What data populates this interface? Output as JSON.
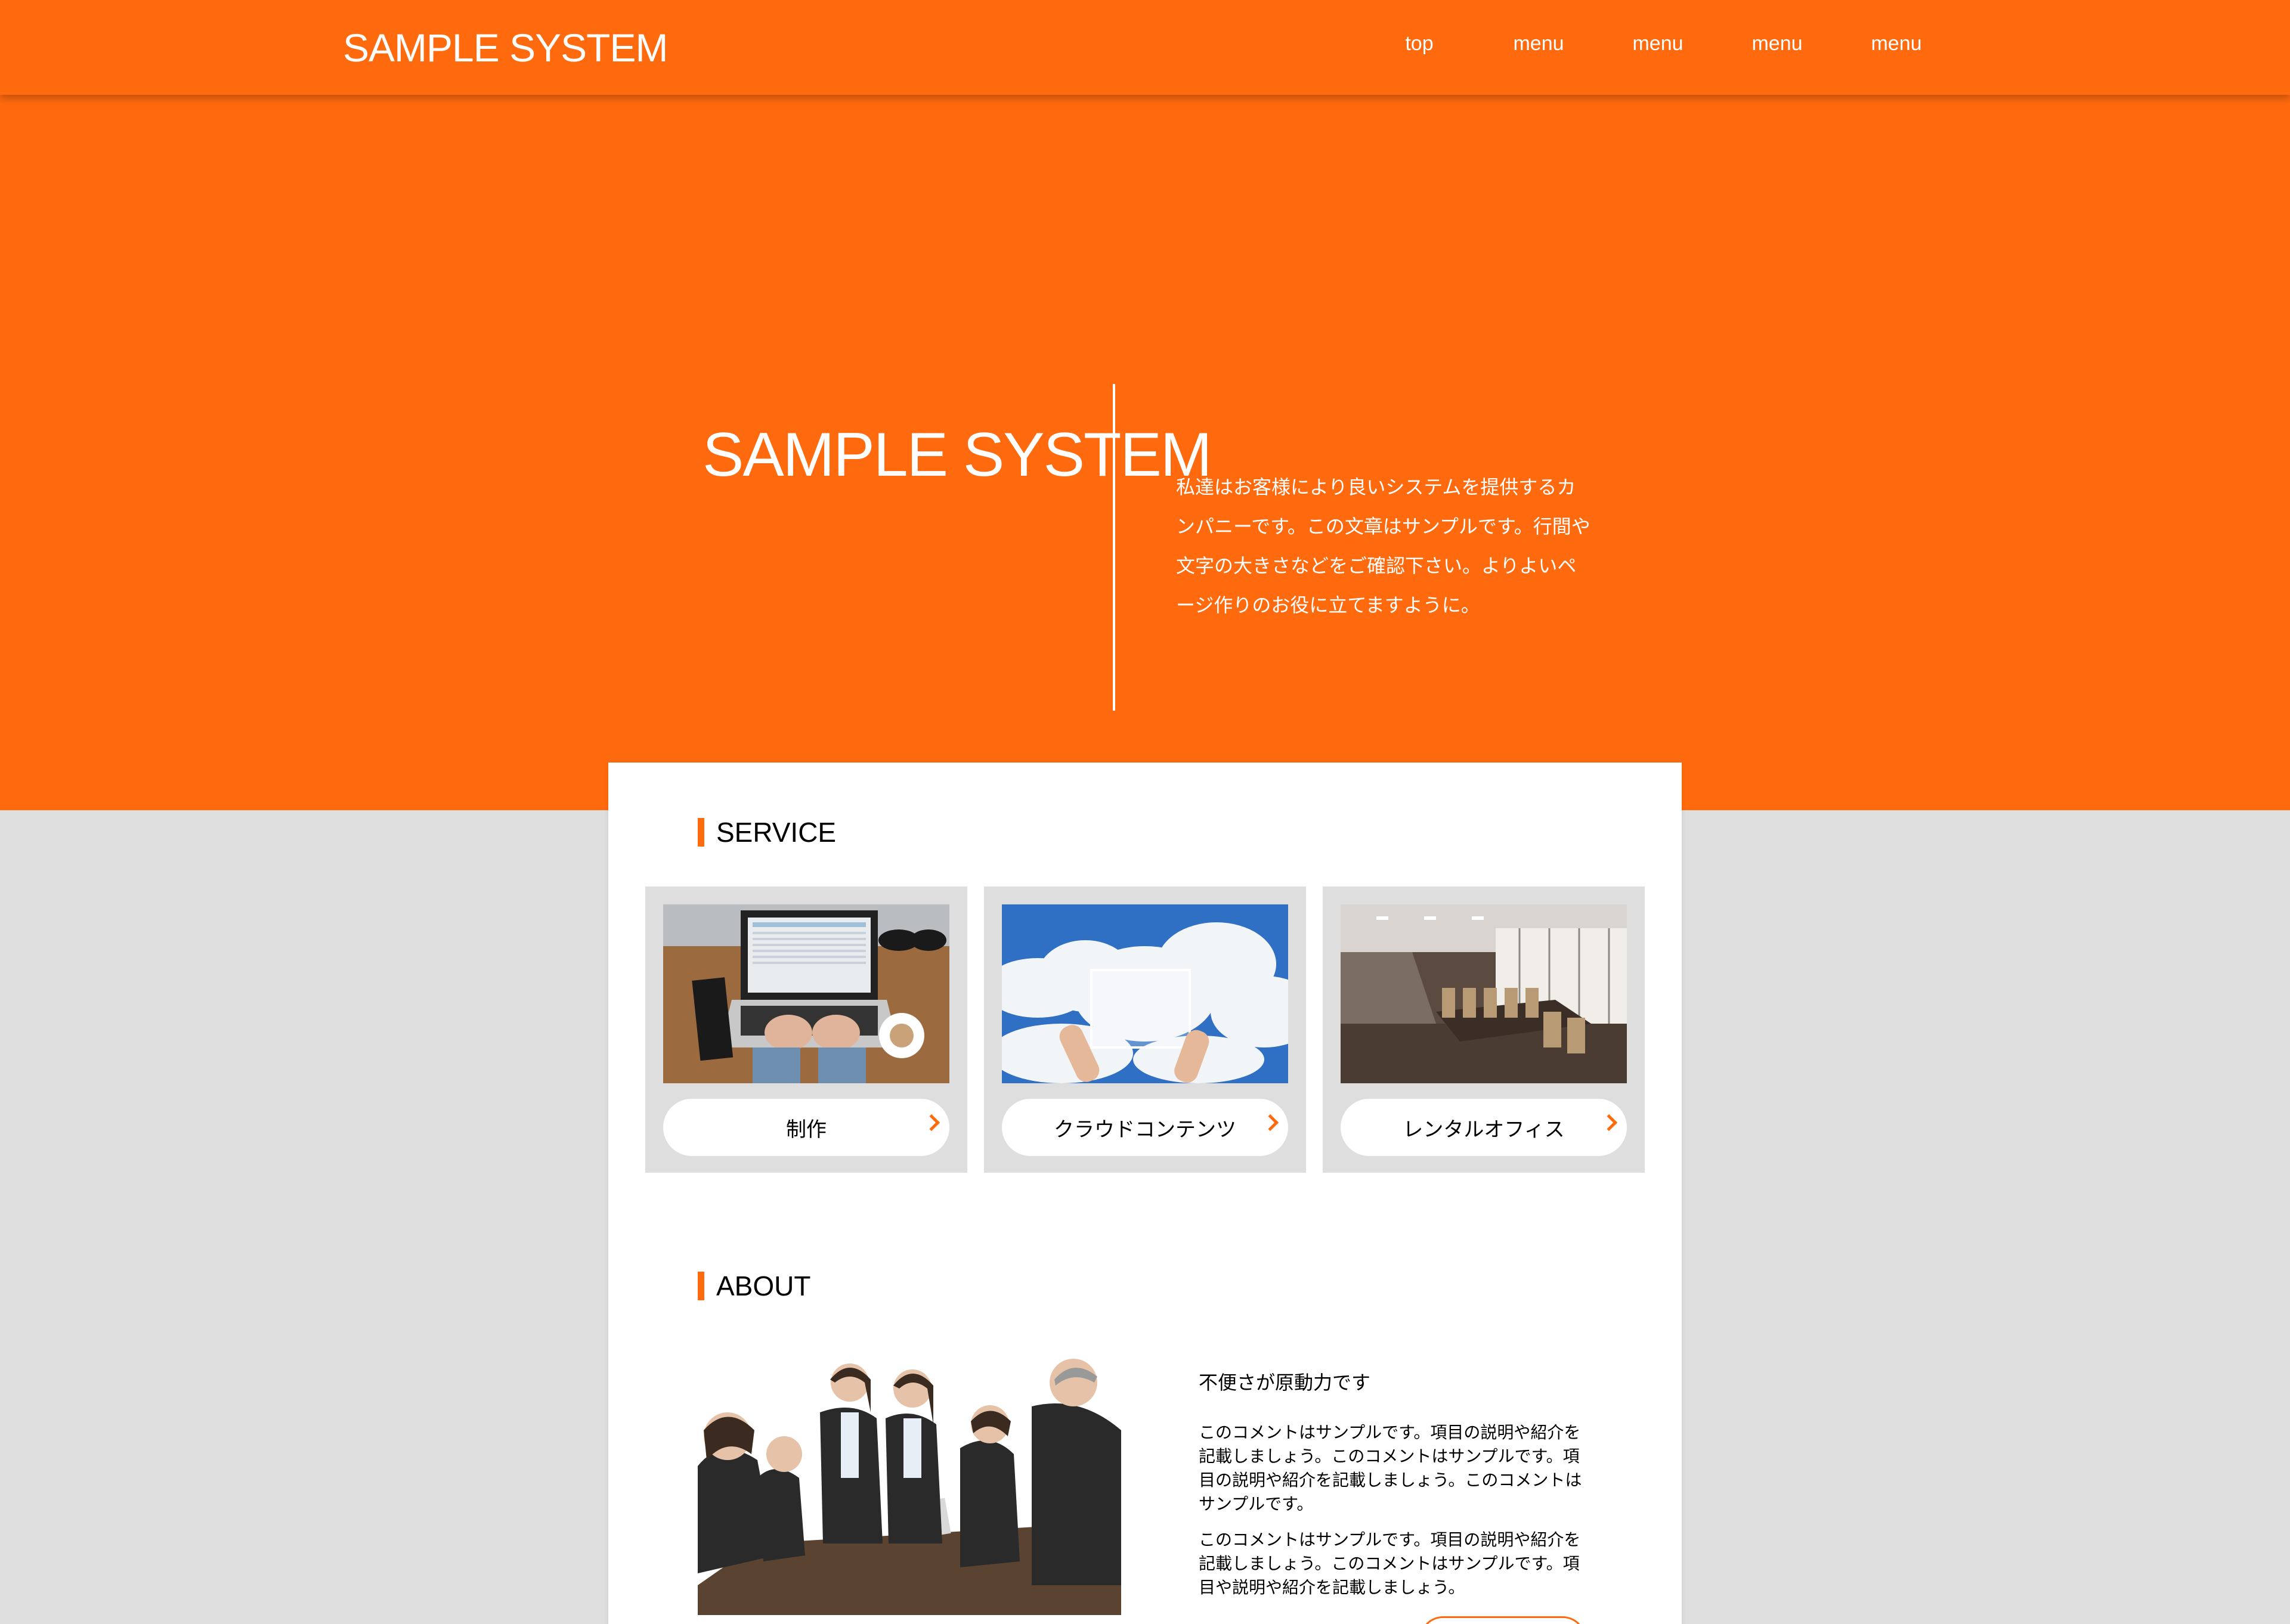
{
  "header": {
    "logo": "SAMPLE SYSTEM",
    "nav": [
      "top",
      "menu",
      "menu",
      "menu",
      "menu"
    ]
  },
  "hero": {
    "title": "SAMPLE SYSTEM",
    "text": "私達はお客様により良いシステムを提供するカンパニーです。この文章はサンプルです。行間や文字の大きさなどをご確認下さい。よりよいページ作りのお役に立てますように。"
  },
  "service": {
    "title": "SERVICE",
    "items": [
      {
        "label": "制作",
        "image": "laptop-desk-image"
      },
      {
        "label": "クラウドコンテンツ",
        "image": "cloud-sky-image"
      },
      {
        "label": "レンタルオフィス",
        "image": "conference-room-image"
      }
    ]
  },
  "about": {
    "title": "ABOUT",
    "heading": "不便さが原動力です",
    "paragraphs": [
      "このコメントはサンプルです。項目の説明や紹介を記載しましょう。このコメントはサンプルです。項目の説明や紹介を記載しましょう。このコメントはサンプルです。",
      "このコメントはサンプルです。項目の説明や紹介を記載しましょう。このコメントはサンプルです。項目や説明や紹介を記載しましょう。"
    ],
    "image": "business-team-photo"
  },
  "colors": {
    "accent": "#ff6a0e",
    "background": "#dedede",
    "card": "#ffffff"
  }
}
